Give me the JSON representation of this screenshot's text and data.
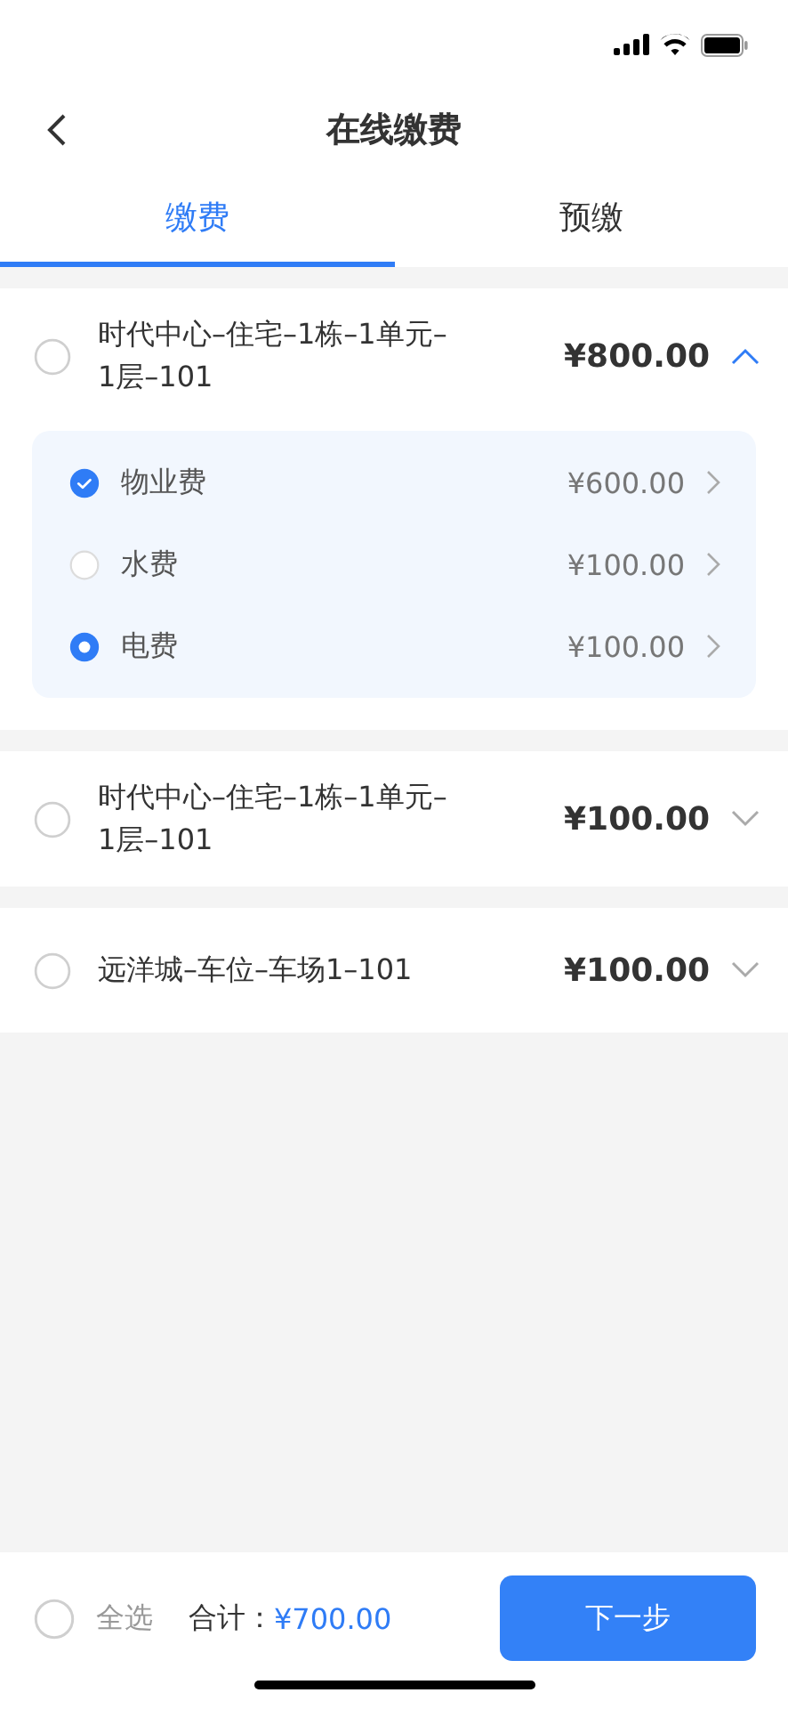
{
  "header": {
    "title": "在线缴费"
  },
  "tabs": [
    {
      "label": "缴费",
      "selected": true
    },
    {
      "label": "预缴",
      "selected": false
    }
  ],
  "properties": [
    {
      "name": "时代中心–住宅–1栋–1单元–1层–101",
      "amount": "¥800.00",
      "checked": false,
      "expanded": true,
      "fees": [
        {
          "name": "物业费",
          "amount": "¥600.00",
          "kind": "tick",
          "checked": true
        },
        {
          "name": "水费",
          "amount": "¥100.00",
          "kind": "tick",
          "checked": false
        },
        {
          "name": "电费",
          "amount": "¥100.00",
          "kind": "dot",
          "checked": true
        }
      ]
    },
    {
      "name": "时代中心–住宅–1栋–1单元–1层–101",
      "amount": "¥100.00",
      "checked": false,
      "expanded": false
    },
    {
      "name": "远洋城–车位–车场1–101",
      "amount": "¥100.00",
      "checked": false,
      "expanded": false
    }
  ],
  "footer": {
    "select_all": "全选",
    "select_all_checked": false,
    "total_label": "合计：",
    "total": "¥700.00",
    "next": "下一步"
  }
}
